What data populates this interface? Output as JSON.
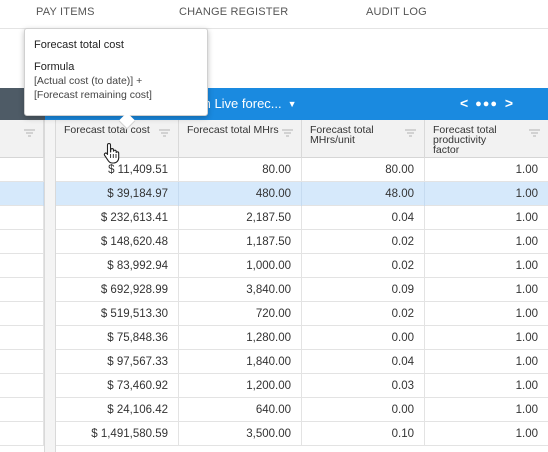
{
  "nav": {
    "items": [
      {
        "label": "PAY ITEMS"
      },
      {
        "label": "CHANGE REGISTER"
      },
      {
        "label": "AUDIT LOG"
      }
    ]
  },
  "toolbar": {
    "view_selector": "m Live forec...",
    "pager_prev": "<",
    "pager_dots": "●●●",
    "pager_next": ">"
  },
  "tooltip": {
    "title": "Forecast total cost",
    "formula_label": "Formula",
    "formula_line1": "[Actual cost (to date)] +",
    "formula_line2": "[Forecast remaining cost]"
  },
  "table": {
    "columns": [
      {
        "label": "Forecast total cost"
      },
      {
        "label": "Forecast total MHrs"
      },
      {
        "label": "Forecast total MHrs/unit"
      },
      {
        "label": "Forecast total productivity factor"
      }
    ],
    "rows": [
      {
        "cells": [
          "$ 11,409.51",
          "80.00",
          "80.00",
          "1.00"
        ],
        "selected": false
      },
      {
        "cells": [
          "$ 39,184.97",
          "480.00",
          "48.00",
          "1.00"
        ],
        "selected": true
      },
      {
        "cells": [
          "$ 232,613.41",
          "2,187.50",
          "0.04",
          "1.00"
        ],
        "selected": false
      },
      {
        "cells": [
          "$ 148,620.48",
          "1,187.50",
          "0.02",
          "1.00"
        ],
        "selected": false
      },
      {
        "cells": [
          "$ 83,992.94",
          "1,000.00",
          "0.02",
          "1.00"
        ],
        "selected": false
      },
      {
        "cells": [
          "$ 692,928.99",
          "3,840.00",
          "0.09",
          "1.00"
        ],
        "selected": false
      },
      {
        "cells": [
          "$ 519,513.30",
          "720.00",
          "0.02",
          "1.00"
        ],
        "selected": false
      },
      {
        "cells": [
          "$ 75,848.36",
          "1,280.00",
          "0.00",
          "1.00"
        ],
        "selected": false
      },
      {
        "cells": [
          "$ 97,567.33",
          "1,840.00",
          "0.04",
          "1.00"
        ],
        "selected": false
      },
      {
        "cells": [
          "$ 73,460.92",
          "1,200.00",
          "0.03",
          "1.00"
        ],
        "selected": false
      },
      {
        "cells": [
          "$ 24,106.42",
          "640.00",
          "0.00",
          "1.00"
        ],
        "selected": false
      },
      {
        "cells": [
          "$ 1,491,580.59",
          "3,500.00",
          "0.10",
          "1.00"
        ],
        "selected": false
      }
    ]
  },
  "colors": {
    "toolbar_blue": "#1a8ae0",
    "selected_row": "#d6e9fb",
    "header_bg": "#f2f2f2"
  }
}
